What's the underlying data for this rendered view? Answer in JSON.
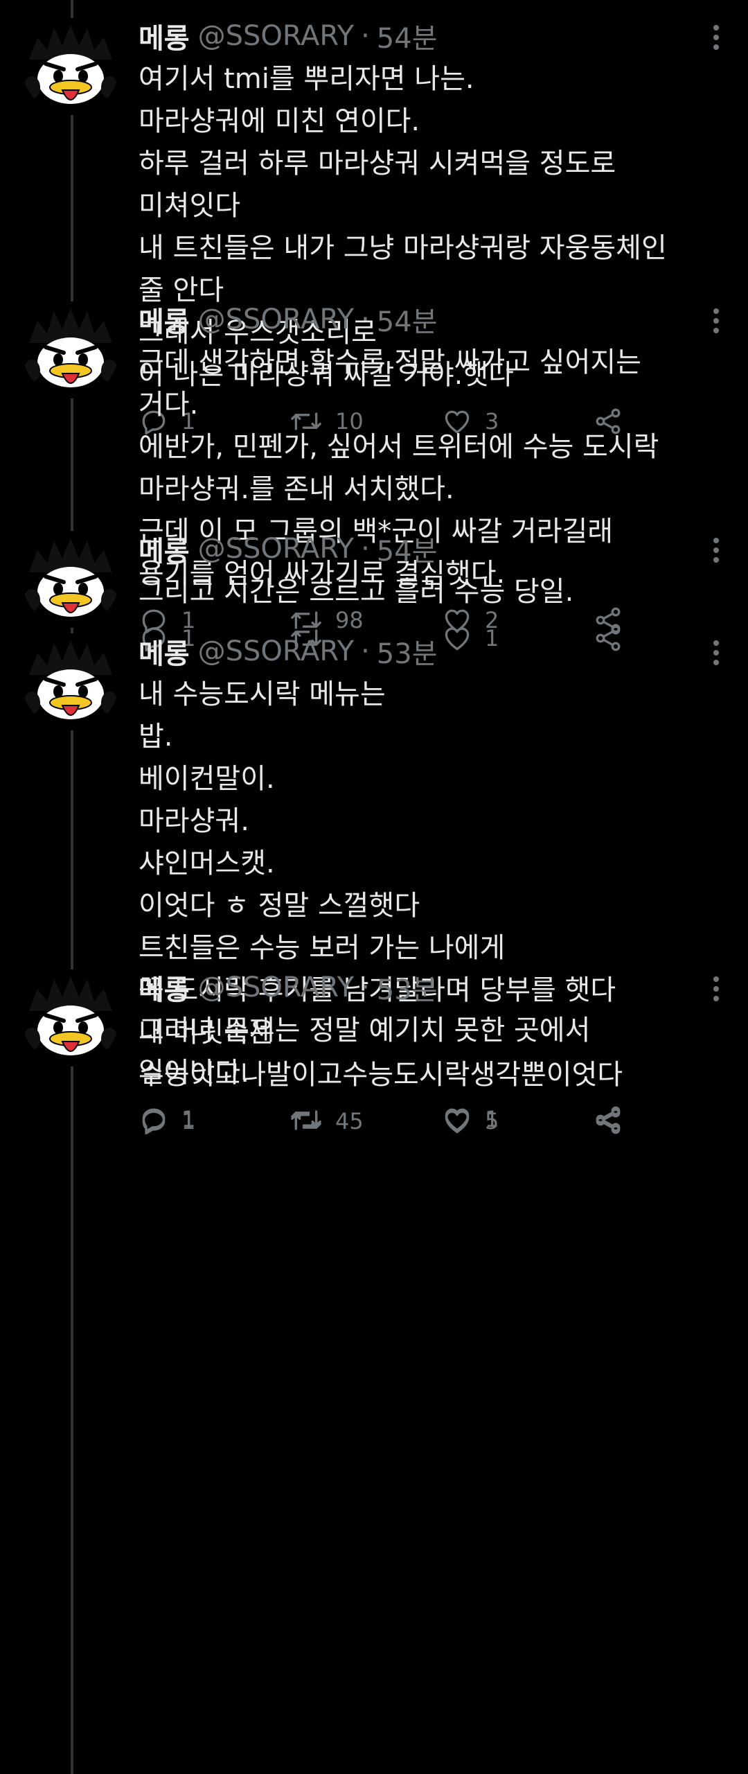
{
  "tweets": [
    {
      "name": "메롱",
      "handle": "@SSORARY",
      "dot": "·",
      "time": "54분",
      "lines": [
        "여기서 tmi를 뿌리자면 나는.",
        "마라샹궈에 미친 연이다.",
        "하루 걸러 하루 마라샹궈 시켜먹을 정도로",
        "미쳐잇다",
        "내 트친들은 내가 그냥 마라샹궈랑 자웅동체인",
        "줄 안다",
        "그래서 우스갯소리로",
        "어 나는 마라샹궈 싸갈 거야.햇다"
      ],
      "replies": "1",
      "retweets": "10",
      "likes": "3"
    },
    {
      "name": "메롱",
      "handle": "@SSORARY",
      "dot": "·",
      "time": "54분",
      "lines": [
        "근데 생각하면 할수록 정말 싸가고 싶어지는",
        "거다.",
        "에반가, 민펜가, 싶어서 트위터에 수능 도시락",
        "마라샹궈.를 존내 서치했다.",
        "근데 이 모 그룹의 백*군이 싸갈 거라길래",
        "용기를 얻어 싸가기로 결심햇다."
      ],
      "replies": "1",
      "retweets": "98",
      "likes": "2"
    },
    {
      "name": "메롱",
      "handle": "@SSORARY",
      "dot": "·",
      "time": "54분",
      "lines": [
        "그리고 시간은 흐르고 흘러 수능 당일."
      ],
      "replies": "1",
      "retweets": "",
      "likes": "1"
    },
    {
      "name": "메롱",
      "handle": "@SSORARY",
      "dot": "·",
      "time": "53분",
      "lines": [
        "내 수능도시락 메뉴는",
        "밥.",
        "베이컨말이.",
        "마라샹궈.",
        "샤인머스캣.",
        "이엇다 ㅎ 정말 스껄햇다",
        "트친들은 수능 보러 가는 나에게",
        "꼭 도시락 후기를 남겨달라며 당부를 햇다",
        "내 머릿속은",
        "수능이고나발이고수능도시락생각뿐이엇다"
      ],
      "replies": "1",
      "retweets": "45",
      "likes": "5"
    },
    {
      "name": "메롱",
      "handle": "@SSORARY",
      "dot": "·",
      "time": "53분",
      "lines": [
        "그러나 문제는 정말 예기치 못한 곳에서",
        "일어낫다."
      ],
      "replies": "1",
      "retweets": "",
      "likes": "1"
    }
  ],
  "icons": {
    "avatar": "badtz-maru-avatar-icon",
    "more": "more-options-icon",
    "reply": "reply-icon",
    "retweet": "retweet-icon",
    "like": "heart-icon",
    "share": "share-icon"
  },
  "colors": {
    "background": "#000000",
    "text": "#e7e9ea",
    "muted": "#71767b",
    "thread_line": "#2f3336",
    "avatar_tongue": "#e0303a",
    "avatar_beak": "#f3c623"
  }
}
